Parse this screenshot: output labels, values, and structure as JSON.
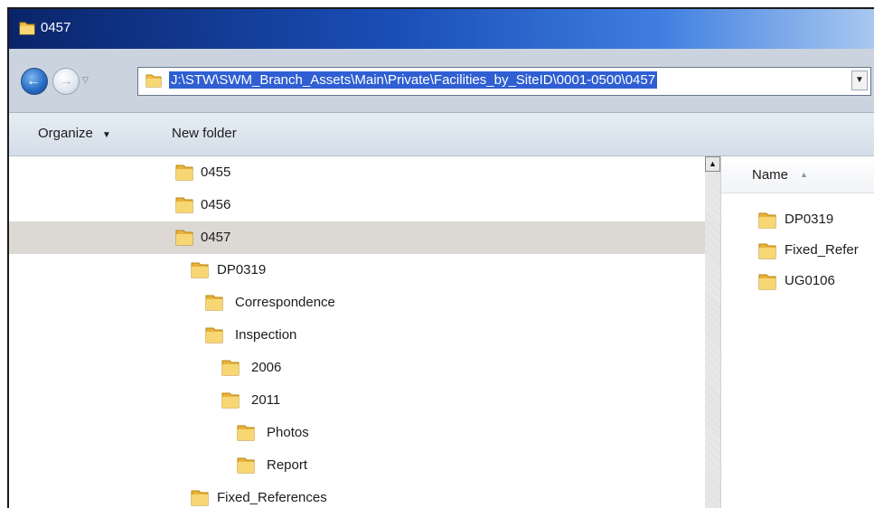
{
  "window": {
    "title": "0457"
  },
  "address": {
    "path": "J:\\STW\\SWM_Branch_Assets\\Main\\Private\\Facilities_by_SiteID\\0001-0500\\0457"
  },
  "toolbar": {
    "organize_label": "Organize",
    "new_folder_label": "New folder"
  },
  "tree": {
    "items": [
      {
        "label": "0455"
      },
      {
        "label": "0456"
      },
      {
        "label": "0457",
        "selected": true
      },
      {
        "label": "DP0319"
      },
      {
        "label": "Correspondence"
      },
      {
        "label": "Inspection"
      },
      {
        "label": "2006"
      },
      {
        "label": "2011"
      },
      {
        "label": "Photos"
      },
      {
        "label": "Report"
      },
      {
        "label": "Fixed_References"
      }
    ]
  },
  "content": {
    "column_header": "Name",
    "items": [
      {
        "label": "DP0319"
      },
      {
        "label": "Fixed_Refer"
      },
      {
        "label": "UG0106"
      }
    ]
  },
  "colors": {
    "title_bar": "#0a246a",
    "selection": "#dcd8d4",
    "address_highlight": "#2f5fd2",
    "folder": "#f1c04a"
  },
  "icons": {
    "folder": "folder-icon",
    "back": "back-arrow-icon",
    "forward": "forward-arrow-icon",
    "dropdown": "chevron-down-icon"
  }
}
